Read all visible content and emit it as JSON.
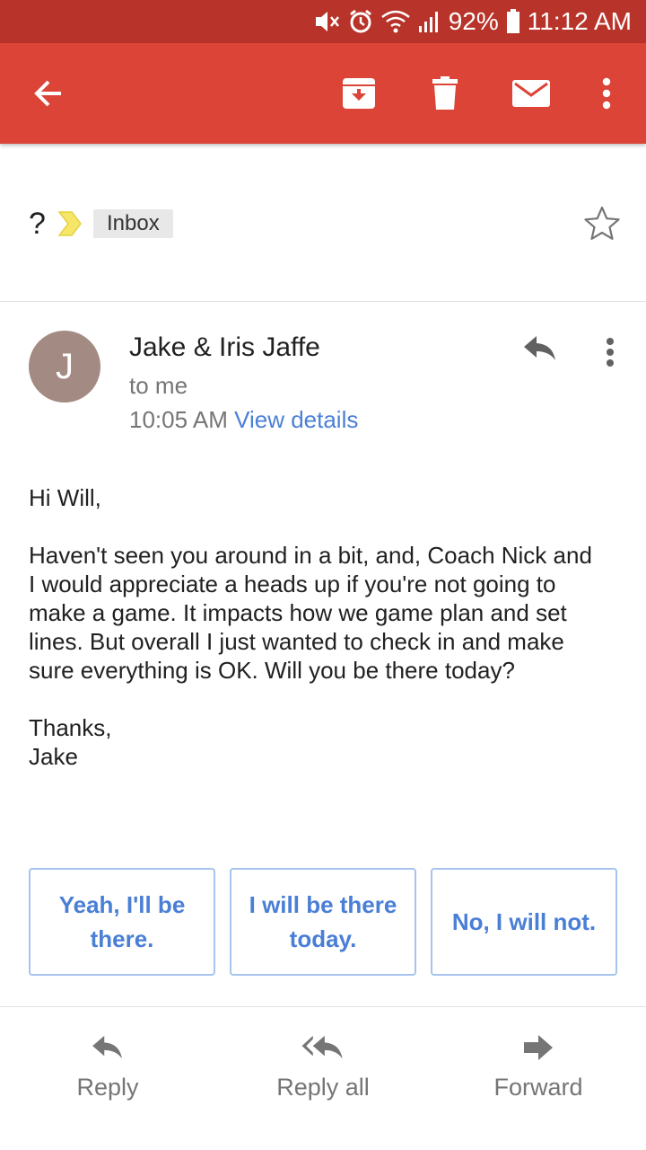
{
  "status_bar": {
    "battery": "92%",
    "time": "11:12 AM"
  },
  "toolbar": {
    "back_icon": "arrow-left-icon",
    "archive_icon": "archive-icon",
    "delete_icon": "trash-icon",
    "mark_unread_icon": "mail-icon",
    "more_icon": "more-vert-icon"
  },
  "message": {
    "subject": "?",
    "label": "Inbox",
    "sender": "Jake & Iris Jaffe",
    "avatar_letter": "J",
    "recipient": "to me",
    "time": "10:05 AM",
    "view_details": "View details",
    "greeting": "Hi Will,",
    "body_lines": [
      "Haven't seen you around in a bit, and, Coach Nick and",
      "I would appreciate a heads up if you're not going to",
      "make a game.  It impacts how we game plan and set",
      "lines.  But overall I just wanted to check in and make",
      "sure everything is OK.  Will you be there today?"
    ],
    "signoff": "Thanks,",
    "signature": "Jake"
  },
  "smart_replies": [
    "Yeah, I'll be there.",
    "I will be there today.",
    "No, I will not."
  ],
  "actions": {
    "reply": "Reply",
    "reply_all": "Reply all",
    "forward": "Forward"
  },
  "colors": {
    "status_bar": "#b8342a",
    "app_bar": "#db4437",
    "link": "#4a7fd6",
    "avatar": "#a38a82",
    "importance": "#f5e66a"
  }
}
